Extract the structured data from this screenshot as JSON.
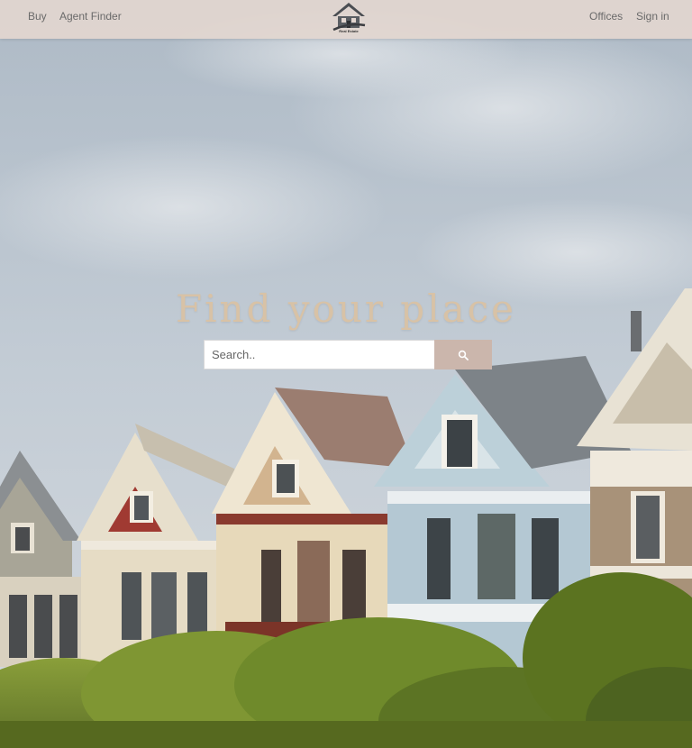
{
  "nav": {
    "buy_label": "Buy",
    "agent_finder_label": "Agent Finder",
    "offices_label": "Offices",
    "sign_in_label": "Sign in",
    "logo_text": "Real Estate",
    "logo_icon": "house-logo-icon"
  },
  "hero": {
    "headline": "Find your place",
    "background": "victorian-houses-photo"
  },
  "search": {
    "placeholder": "Search..",
    "value": "",
    "button_icon": "search-icon"
  },
  "colors": {
    "nav_background": "#e2d6d0",
    "headline": "#d8c2a6",
    "search_button": "#cbb6ac",
    "nav_text": "#6a6a6a"
  }
}
